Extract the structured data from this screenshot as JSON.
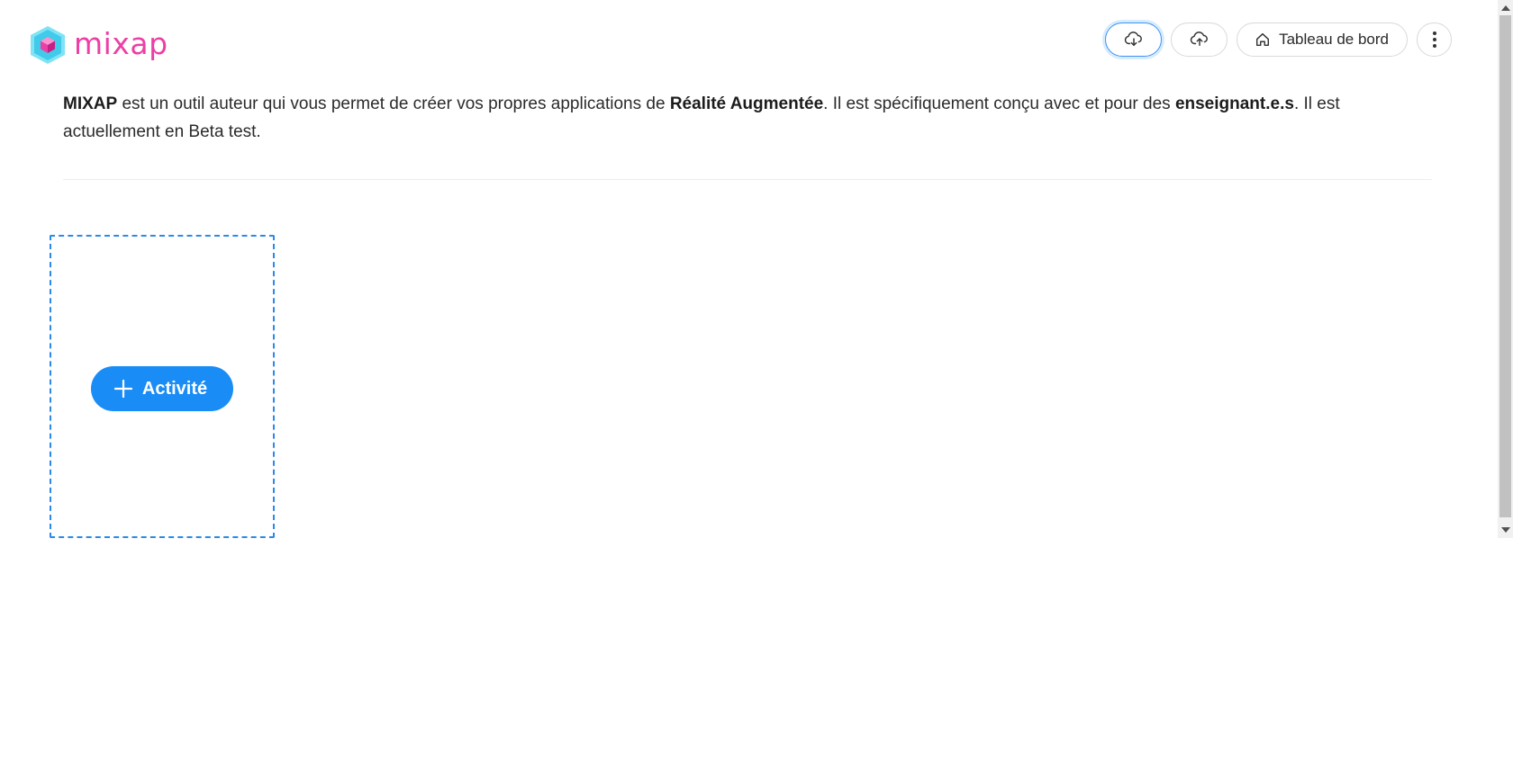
{
  "app": {
    "logo_text": "mixap",
    "brand_color": "#ec3fa6",
    "accent_color": "#1a8cf5"
  },
  "toolbar": {
    "download_icon": "cloud-download-icon",
    "upload_icon": "cloud-upload-icon",
    "dashboard_icon": "home-icon",
    "dashboard_label": "Tableau de bord",
    "menu_icon": "more-vertical-icon"
  },
  "description": {
    "part1": "MIXAP",
    "part2": " est un outil auteur qui vous permet de créer vos propres applications de ",
    "part3": "Réalité Augmentée",
    "part4": ". Il est spécifiquement conçu avec et pour des ",
    "part5": "enseignant.e.s",
    "part6": ". Il est actuellement en Beta test."
  },
  "add_activity": {
    "icon": "plus-icon",
    "label": "Activité"
  }
}
